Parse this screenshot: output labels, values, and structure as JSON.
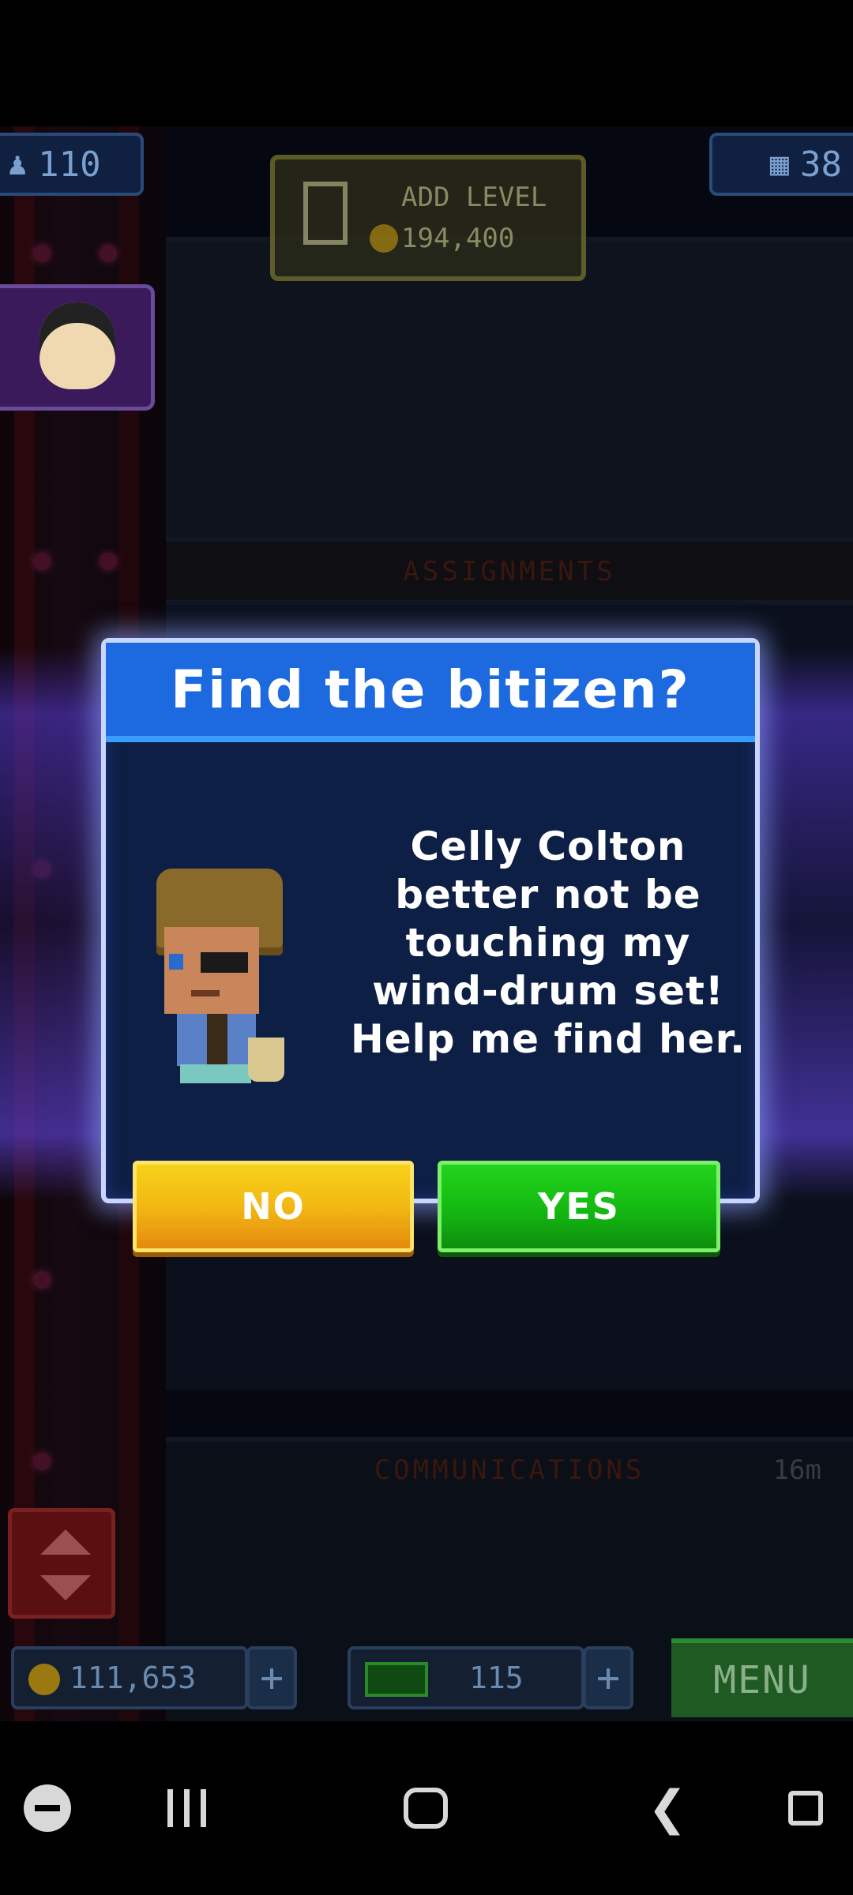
{
  "hud": {
    "population": "110",
    "floors": "38",
    "add_level_label": "ADD LEVEL",
    "add_level_cost": "194,400",
    "coins": "111,653",
    "bux": "115",
    "menu_label": "MENU"
  },
  "floors": {
    "assignments_label": "ASSIGNMENTS",
    "communications_label": "COMMUNICATIONS",
    "communications_timer": "16m"
  },
  "dialog": {
    "title": "Find the bitizen?",
    "message_lines": [
      "Celly Colton",
      "better not be",
      "touching my",
      "wind-drum set!",
      "Help me find her."
    ],
    "no_label": "NO",
    "yes_label": "YES"
  },
  "icons": {
    "population": "person-icon",
    "floors": "building-icon",
    "add_level": "add-floor-icon",
    "coin": "coin-icon",
    "bux": "bux-icon",
    "elevator": "elevator-arrows-icon"
  },
  "colors": {
    "dialog_header": "#1d6ae0",
    "dialog_body": "#0d1f45",
    "no_button": "#f2b814",
    "yes_button": "#14b812"
  }
}
